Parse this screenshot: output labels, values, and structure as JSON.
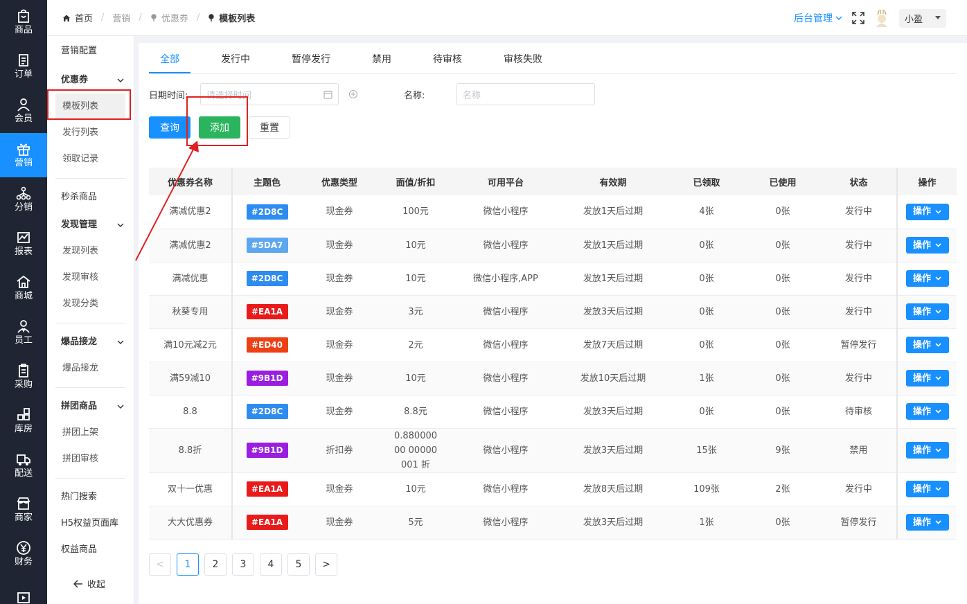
{
  "leftbar": [
    {
      "label": "商品",
      "icon": "bag-icon"
    },
    {
      "label": "订单",
      "icon": "order-icon"
    },
    {
      "label": "会员",
      "icon": "user-icon"
    },
    {
      "label": "营销",
      "icon": "gift-icon"
    },
    {
      "label": "分销",
      "icon": "network-icon"
    },
    {
      "label": "报表",
      "icon": "chart-icon"
    },
    {
      "label": "商城",
      "icon": "home-icon"
    },
    {
      "label": "员工",
      "icon": "staff-icon"
    },
    {
      "label": "采购",
      "icon": "clipboard-icon"
    },
    {
      "label": "库房",
      "icon": "warehouse-icon"
    },
    {
      "label": "配送",
      "icon": "truck-icon"
    },
    {
      "label": "商家",
      "icon": "store-icon"
    },
    {
      "label": "财务",
      "icon": "yen-icon"
    },
    {
      "label": "",
      "icon": "video-icon"
    }
  ],
  "submenu": {
    "marketing_config": "营销配置",
    "coupon_section": "优惠券",
    "coupon_items": [
      "模板列表",
      "发行列表",
      "领取记录"
    ],
    "flash_sale": "秒杀商品",
    "discover_section": "发现管理",
    "discover_items": [
      "发现列表",
      "发现审核",
      "发现分类"
    ],
    "hot_section": "爆品接龙",
    "hot_items": [
      "爆品接龙"
    ],
    "group_section": "拼团商品",
    "group_items": [
      "拼团上架",
      "拼团审核"
    ],
    "other_items": [
      "热门搜索",
      "H5权益页面库",
      "权益商品"
    ],
    "collapse": "收起"
  },
  "breadcrumb": [
    "首页",
    "营销",
    "优惠券",
    "模板列表"
  ],
  "header": {
    "admin": "后台管理",
    "user": "小盈"
  },
  "tabs": [
    "全部",
    "发行中",
    "暂停发行",
    "禁用",
    "待审核",
    "审核失败"
  ],
  "filters": {
    "date_label": "日期时间:",
    "date_placeholder": "请选择时间",
    "name_label": "名称:",
    "name_placeholder": "名称"
  },
  "buttons": {
    "query": "查询",
    "add": "添加",
    "reset": "重置"
  },
  "table": {
    "headers": [
      "优惠券名称",
      "主题色",
      "优惠类型",
      "面值/折扣",
      "可用平台",
      "有效期",
      "已领取",
      "已使用",
      "状态",
      "操作"
    ],
    "op_label": "操作",
    "rows": [
      {
        "name": "满减优惠2",
        "color": "#2D8C",
        "color_hex": "#2d8cf0",
        "type": "现金券",
        "value": "100元",
        "platform": "微信小程序",
        "validity": "发放1天后过期",
        "received": "4张",
        "used": "0张",
        "status": "发行中"
      },
      {
        "name": "满减优惠2",
        "color": "#5DA7",
        "color_hex": "#5da7f0",
        "type": "现金券",
        "value": "10元",
        "platform": "微信小程序",
        "validity": "发放1天后过期",
        "received": "0张",
        "used": "0张",
        "status": "发行中"
      },
      {
        "name": "满减优惠",
        "color": "#2D8C",
        "color_hex": "#2d8cf0",
        "type": "现金券",
        "value": "10元",
        "platform": "微信小程序,APP",
        "validity": "发放1天后过期",
        "received": "0张",
        "used": "0张",
        "status": "发行中"
      },
      {
        "name": "秋葵专用",
        "color": "#EA1A",
        "color_hex": "#ea1a1a",
        "type": "现金券",
        "value": "3元",
        "platform": "微信小程序",
        "validity": "发放3天后过期",
        "received": "0张",
        "used": "0张",
        "status": "发行中"
      },
      {
        "name": "满10元减2元",
        "color": "#ED40",
        "color_hex": "#ed4014",
        "type": "现金券",
        "value": "2元",
        "platform": "微信小程序",
        "validity": "发放7天后过期",
        "received": "0张",
        "used": "0张",
        "status": "暂停发行"
      },
      {
        "name": "满59减10",
        "color": "#9B1D",
        "color_hex": "#9b1de0",
        "type": "现金券",
        "value": "10元",
        "platform": "微信小程序",
        "validity": "发放10天后过期",
        "received": "1张",
        "used": "0张",
        "status": "发行中"
      },
      {
        "name": "8.8",
        "color": "#2D8C",
        "color_hex": "#2d8cf0",
        "type": "现金券",
        "value": "8.8元",
        "platform": "微信小程序",
        "validity": "发放3天后过期",
        "received": "0张",
        "used": "0张",
        "status": "待审核"
      },
      {
        "name": "8.8折",
        "color": "#9B1D",
        "color_hex": "#9b1de0",
        "type": "折扣券",
        "value": "0.88000000 00000001 折",
        "platform": "微信小程序",
        "validity": "发放3天后过期",
        "received": "15张",
        "used": "9张",
        "status": "禁用"
      },
      {
        "name": "双十一优惠",
        "color": "#EA1A",
        "color_hex": "#ea1a1a",
        "type": "现金券",
        "value": "10元",
        "platform": "微信小程序",
        "validity": "发放8天后过期",
        "received": "109张",
        "used": "2张",
        "status": "发行中"
      },
      {
        "name": "大大优惠券",
        "color": "#EA1A",
        "color_hex": "#ea1a1a",
        "type": "现金券",
        "value": "5元",
        "platform": "微信小程序",
        "validity": "发放3天后过期",
        "received": "1张",
        "used": "0张",
        "status": "暂停发行"
      }
    ]
  },
  "pagination": {
    "prev": "<",
    "pages": [
      "1",
      "2",
      "3",
      "4",
      "5"
    ],
    "next": ">",
    "current": "1"
  }
}
